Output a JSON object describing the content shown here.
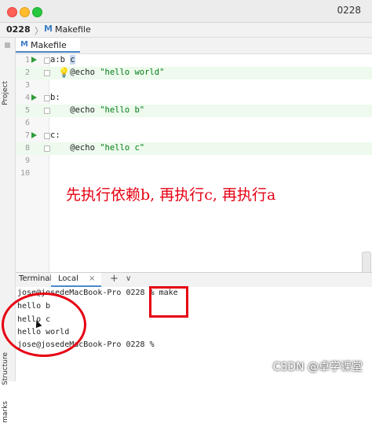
{
  "window": {
    "title_right": "0228"
  },
  "navbar": {
    "project": "0228",
    "separator": "〉",
    "file_icon": "M",
    "file": "Makefile"
  },
  "tabs": [
    {
      "icon": "M",
      "label": "Makefile"
    }
  ],
  "sidebar": {
    "project_label": "Project",
    "structure_label": "Structure",
    "marks_label": "marks"
  },
  "editor": {
    "lines": [
      {
        "num": "1",
        "text_target": "a:b ",
        "text_dep": "c",
        "run": true,
        "fold": true
      },
      {
        "num": "2",
        "text": "    @echo ",
        "str": "\"hello world\"",
        "bulb": true,
        "fold": true
      },
      {
        "num": "3",
        "text": ""
      },
      {
        "num": "4",
        "text": "b:",
        "run": true,
        "fold": true
      },
      {
        "num": "5",
        "text": "    @echo ",
        "str": "\"hello b\"",
        "fold": true
      },
      {
        "num": "6",
        "text": ""
      },
      {
        "num": "7",
        "text": "c:",
        "run": true,
        "fold": true
      },
      {
        "num": "8",
        "text": "    @echo ",
        "str": "\"hello c\"",
        "fold": true
      },
      {
        "num": "9",
        "text": ""
      },
      {
        "num": "10",
        "text": ""
      }
    ]
  },
  "annotation": "先执行依赖b, 再执行c, 再执行a",
  "terminal": {
    "label": "Terminal:",
    "tab": "Local",
    "close": "×",
    "plus": "+",
    "chevron": "∨",
    "lines": [
      "jose@josedeMacBook-Pro 0228 % make",
      "hello b",
      "hello c",
      "hello world",
      "jose@josedeMacBook-Pro 0228 %"
    ]
  },
  "watermark": "CSDN @卓学课堂",
  "colors": {
    "accent": "#4a88c7",
    "annotation_red": "#e60012",
    "run_green": "#2e9d38",
    "string_green": "#067d17"
  }
}
